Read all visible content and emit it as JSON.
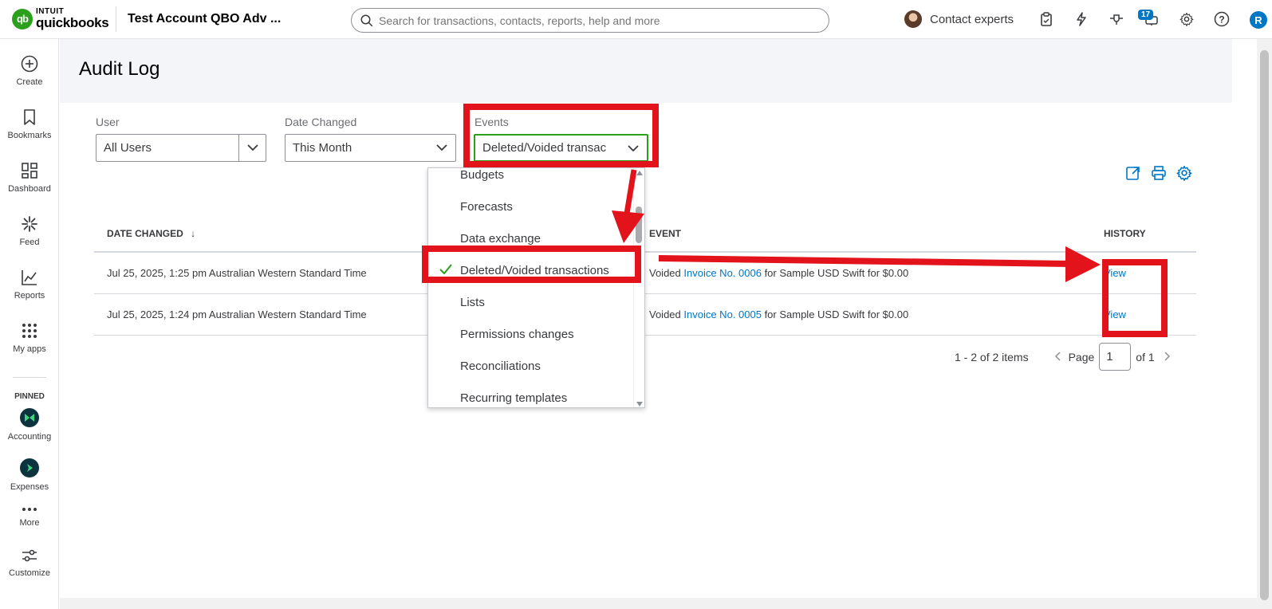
{
  "topbar": {
    "logo_small": "INTUIT",
    "logo_large": "quickbooks",
    "company": "Test Account QBO Adv ...",
    "search_placeholder": "Search for transactions, contacts, reports, help and more",
    "contact_experts": "Contact experts",
    "notifications_count": "17",
    "user_initial": "R"
  },
  "sidebar": {
    "items": [
      {
        "label": "Create",
        "icon": "plus-circle-icon"
      },
      {
        "label": "Bookmarks",
        "icon": "bookmark-icon"
      },
      {
        "label": "Dashboard",
        "icon": "dashboard-icon"
      },
      {
        "label": "Feed",
        "icon": "feed-icon"
      },
      {
        "label": "Reports",
        "icon": "chart-line-icon"
      },
      {
        "label": "My apps",
        "icon": "grid-dots-icon"
      }
    ],
    "pinned_heading": "PINNED",
    "pinned": [
      {
        "label": "Accounting"
      },
      {
        "label": "Expenses"
      }
    ],
    "more": "More",
    "customize": "Customize"
  },
  "page": {
    "title": "Audit Log"
  },
  "filters": {
    "user_label": "User",
    "user_value": "All Users",
    "date_label": "Date Changed",
    "date_value": "This Month",
    "events_label": "Events",
    "events_value": "Deleted/Voided transac"
  },
  "events_dropdown": {
    "options": [
      "Budgets",
      "Forecasts",
      "Data exchange",
      "Deleted/Voided transactions",
      "Lists",
      "Permissions changes",
      "Reconciliations",
      "Recurring templates"
    ],
    "selected": "Deleted/Voided transactions"
  },
  "table": {
    "headers": {
      "date": "DATE CHANGED",
      "sort_arrow": "↓",
      "event": "EVENT",
      "history": "HISTORY"
    },
    "rows": [
      {
        "date": "Jul 25, 2025, 1:25 pm Australian Western Standard Time",
        "event_prefix": "Voided ",
        "event_link": "Invoice No. 0006",
        "event_suffix": " for Sample USD Swift for $0.00",
        "history": "View"
      },
      {
        "date": "Jul 25, 2025, 1:24 pm Australian Western Standard Time",
        "event_prefix": "Voided ",
        "event_link": "Invoice No. 0005",
        "event_suffix": " for Sample USD Swift for $0.00",
        "history": "View"
      }
    ]
  },
  "pager": {
    "summary": "1 - 2 of 2 items",
    "page_label": "Page",
    "page_value": "1",
    "of_label": "of 1"
  },
  "colors": {
    "brand_green": "#2ca01c",
    "link_blue": "#0077c5",
    "annotation_red": "#e3131c"
  }
}
